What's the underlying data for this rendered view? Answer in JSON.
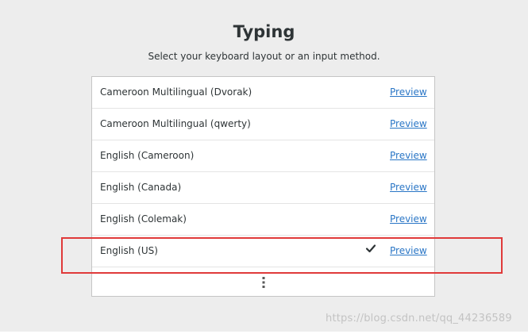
{
  "page": {
    "title": "Typing",
    "subtitle": "Select your keyboard layout or an input method."
  },
  "layouts": [
    {
      "label": "Cameroon Multilingual (Dvorak)",
      "preview_label": "Preview",
      "selected": false
    },
    {
      "label": "Cameroon Multilingual (qwerty)",
      "preview_label": "Preview",
      "selected": false
    },
    {
      "label": "English (Cameroon)",
      "preview_label": "Preview",
      "selected": false
    },
    {
      "label": "English (Canada)",
      "preview_label": "Preview",
      "selected": false
    },
    {
      "label": "English (Colemak)",
      "preview_label": "Preview",
      "selected": false
    },
    {
      "label": "English (US)",
      "preview_label": "Preview",
      "selected": true
    }
  ],
  "more_button": {
    "icon": "vertical-ellipsis-icon"
  },
  "selected_icon": "checkmark-icon",
  "annotation": {
    "highlight_color": "#e03a3a"
  },
  "watermark": "https://blog.csdn.net/qq_44236589",
  "colors": {
    "background": "#ededed",
    "link": "#2a76c6",
    "text": "#2e3436"
  }
}
